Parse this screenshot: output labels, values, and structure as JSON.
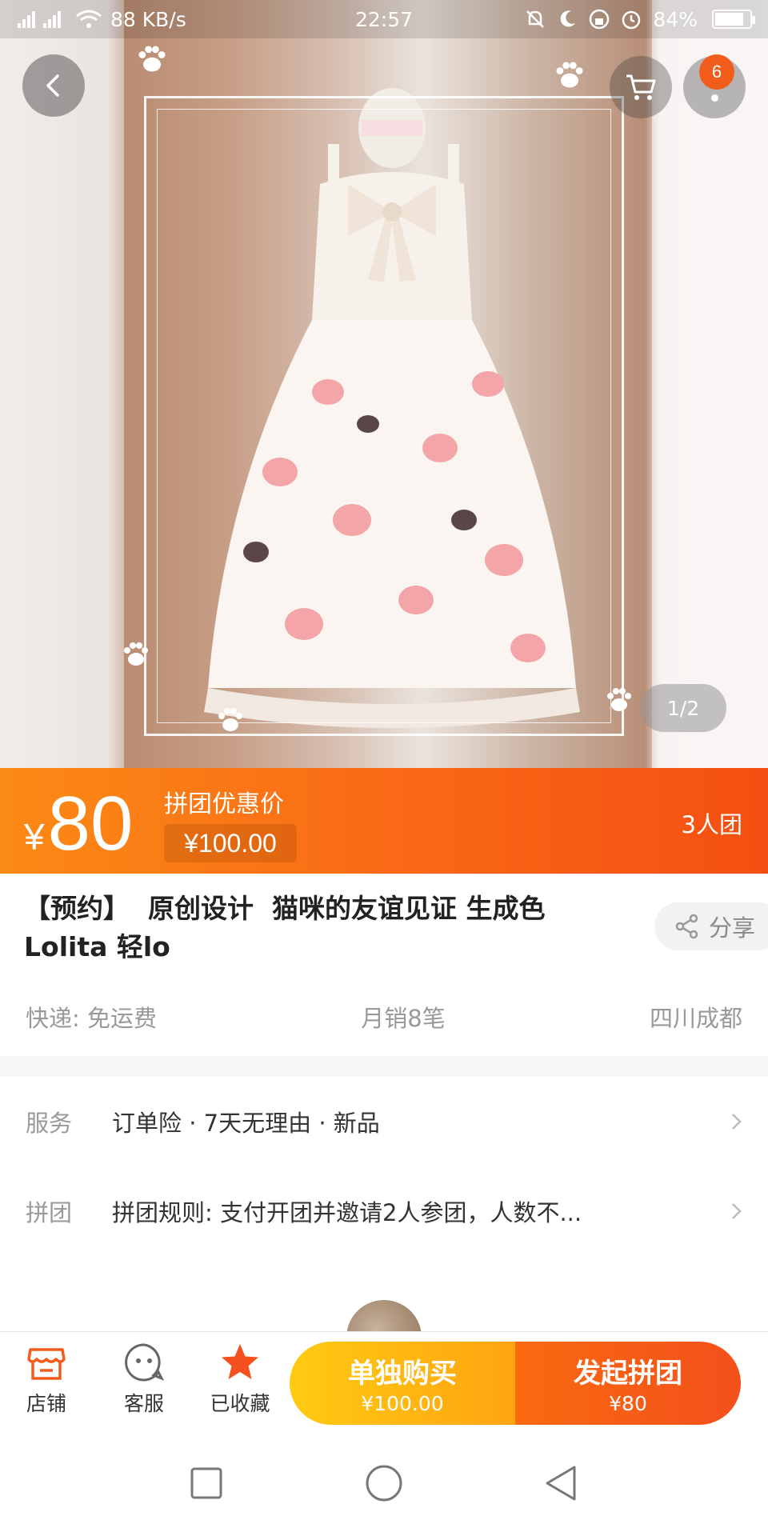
{
  "status_bar": {
    "network": "4G 3G",
    "speed": "88 KB/s",
    "time": "22:57",
    "battery": "84%",
    "battery_level": 0.84
  },
  "hero": {
    "image_counter": "1/2",
    "cart_badge": "6"
  },
  "price": {
    "currency": "¥",
    "amount": "80",
    "promo_label": "拼团优惠价",
    "original_price": "¥100.00",
    "group_size": "3人团"
  },
  "product": {
    "title_line1": "【预约】  原创设计  猫咪的友谊见证 生成色",
    "title_line2": "Lolita 轻lo",
    "share_label": "分享",
    "shipping": "快递: 免运费",
    "monthly_sales": "月销8笔",
    "location": "四川成都"
  },
  "service": {
    "label": "服务",
    "value": "订单险 · 7天无理由 · 新品"
  },
  "group_rule": {
    "label": "拼团",
    "value": "拼团规则: 支付开团并邀请2人参团，人数不..."
  },
  "action_bar": {
    "store_label": "店铺",
    "service_label": "客服",
    "favorite_label": "已收藏",
    "buy_single_title": "单独购买",
    "buy_single_price": "¥100.00",
    "buy_group_title": "发起拼团",
    "buy_group_price": "¥80"
  },
  "colors": {
    "accent_orange": "#fa6a16",
    "buy_single_yellow": "#ffb811",
    "favorite_star": "#f4511e"
  }
}
